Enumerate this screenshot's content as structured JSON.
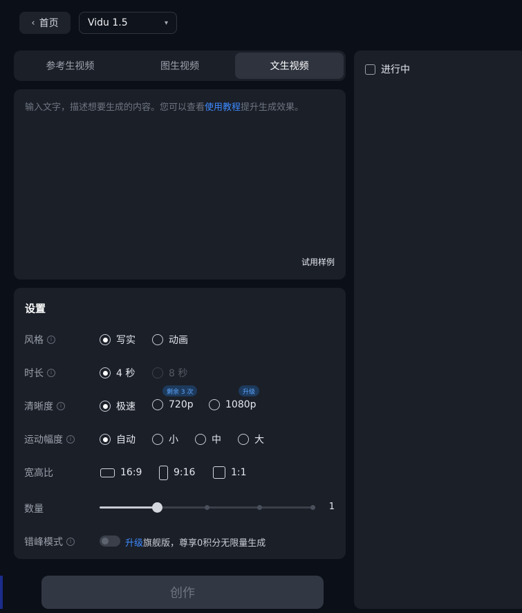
{
  "header": {
    "home_label": "首页",
    "model_value": "Vidu 1.5"
  },
  "tabs": [
    {
      "label": "参考生视频",
      "active": false
    },
    {
      "label": "图生视频",
      "active": false
    },
    {
      "label": "文生视频",
      "active": true
    }
  ],
  "prompt": {
    "placeholder_before": "输入文字，描述想要生成的内容。您可以查看",
    "placeholder_link": "使用教程",
    "placeholder_after": "提升生成效果。",
    "sample_label": "试用样例"
  },
  "settings": {
    "title": "设置",
    "style": {
      "label": "风格",
      "options": [
        "写实",
        "动画"
      ],
      "selected": "写实"
    },
    "duration": {
      "label": "时长",
      "options": [
        "4 秒",
        "8 秒"
      ],
      "selected": "4 秒",
      "disabled": [
        "8 秒"
      ]
    },
    "resolution": {
      "label": "清晰度",
      "options": [
        "极速",
        "720p",
        "1080p"
      ],
      "selected": "极速",
      "badge_720": "剩余 3 次",
      "badge_1080": "升级"
    },
    "motion": {
      "label": "运动幅度",
      "options": [
        "自动",
        "小",
        "中",
        "大"
      ],
      "selected": "自动"
    },
    "aspect": {
      "label": "宽高比",
      "options": [
        "16:9",
        "9:16",
        "1:1"
      ]
    },
    "quantity": {
      "label": "数量",
      "value": "1",
      "level_fraction": 0.267
    },
    "offpeak": {
      "label": "错峰模式",
      "enabled": false,
      "upgrade_link": "升级",
      "upgrade_text": "旗舰版，尊享0积分无限量生成"
    }
  },
  "create_label": "创作",
  "right_panel": {
    "in_progress_label": "进行中"
  },
  "colors": {
    "accent": "#3d8bff",
    "panel": "#1b1f28",
    "background": "#0b0f17"
  }
}
